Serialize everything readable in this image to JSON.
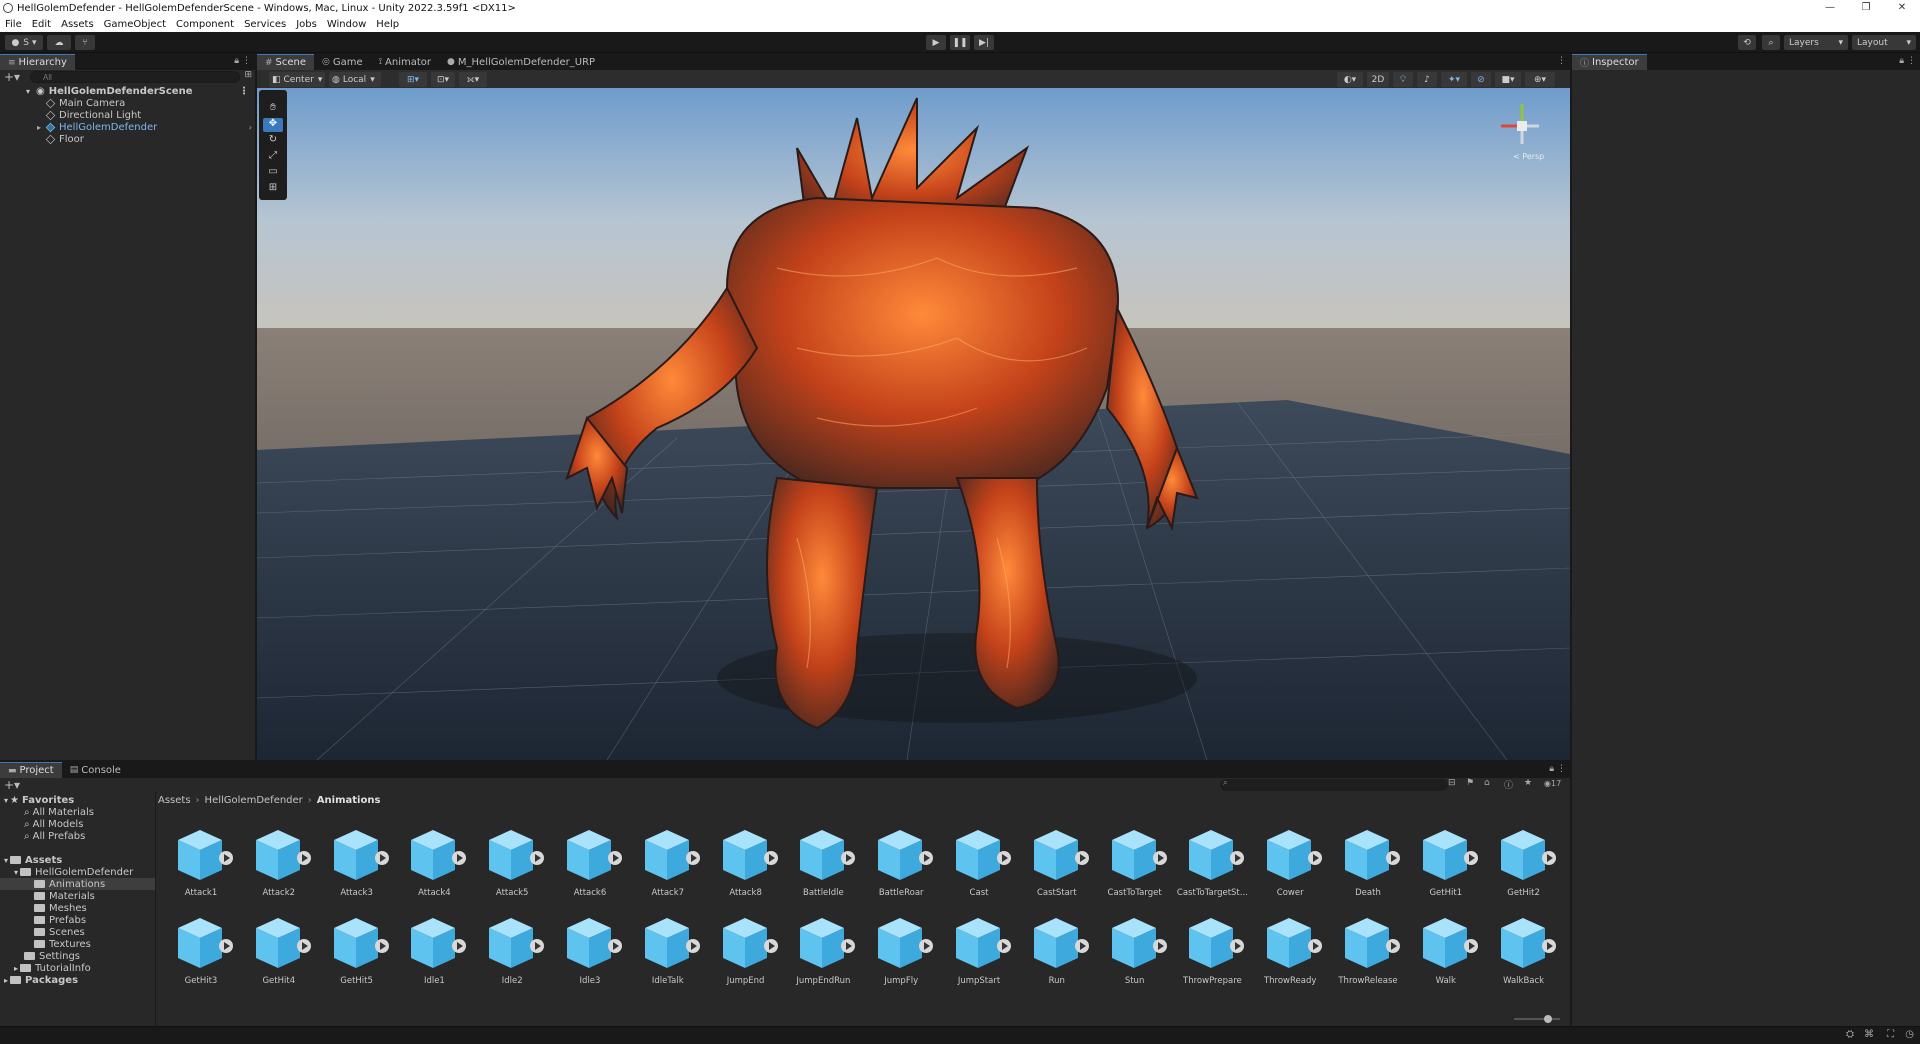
{
  "window": {
    "title": "HellGolemDefender - HellGolemDefenderScene - Windows, Mac, Linux - Unity 2022.3.59f1 <DX11>",
    "controls": [
      "—",
      "❐",
      "✕"
    ]
  },
  "menu": [
    "File",
    "Edit",
    "Assets",
    "GameObject",
    "Component",
    "Services",
    "Jobs",
    "Window",
    "Help"
  ],
  "toolbar": {
    "account": "S",
    "layers": "Layers",
    "layout": "Layout"
  },
  "hierarchy": {
    "tab": "Hierarchy",
    "search_placeholder": "All",
    "scene": "HellGolemDefenderScene",
    "items": [
      "Main Camera",
      "Directional Light",
      "HellGolemDefender",
      "Floor"
    ]
  },
  "scene_tabs": [
    "Scene",
    "Game",
    "Animator",
    "M_HellGolemDefender_URP"
  ],
  "scene_toolbar": {
    "pivot": "Center",
    "space": "Local",
    "mode_2d": "2D",
    "gizmo_label": "< Persp"
  },
  "inspector": {
    "tab": "Inspector"
  },
  "project": {
    "tabs": [
      "Project",
      "Console"
    ],
    "hidden_count": "17",
    "favorites": {
      "label": "Favorites",
      "items": [
        "All Materials",
        "All Models",
        "All Prefabs"
      ]
    },
    "assets_root": "Assets",
    "tree": [
      "HellGolemDefender",
      "Animations",
      "Materials",
      "Meshes",
      "Prefabs",
      "Scenes",
      "Textures",
      "Settings",
      "TutorialInfo"
    ],
    "packages": "Packages",
    "breadcrumb": [
      "Assets",
      "HellGolemDefender",
      "Animations"
    ],
    "assets_row1": [
      "Attack1",
      "Attack2",
      "Attack3",
      "Attack4",
      "Attack5",
      "Attack6",
      "Attack7",
      "Attack8",
      "BattleIdle",
      "BattleRoar",
      "Cast",
      "CastStart",
      "CastToTarget",
      "CastToTargetSt...",
      "Cower",
      "Death",
      "GetHit1",
      "GetHit2"
    ],
    "assets_row2": [
      "GetHit3",
      "GetHit4",
      "GetHit5",
      "Idle1",
      "Idle2",
      "Idle3",
      "IdleTalk",
      "JumpEnd",
      "JumpEndRun",
      "JumpFly",
      "JumpStart",
      "Run",
      "Stun",
      "ThrowPrepare",
      "ThrowReady",
      "ThrowRelease",
      "Walk",
      "WalkBack"
    ]
  },
  "colors": {
    "accent": "#3a79bb",
    "panel": "#282828",
    "dark": "#191919",
    "asset_blue": "#5fc3f0",
    "lava": "#d2531c"
  }
}
